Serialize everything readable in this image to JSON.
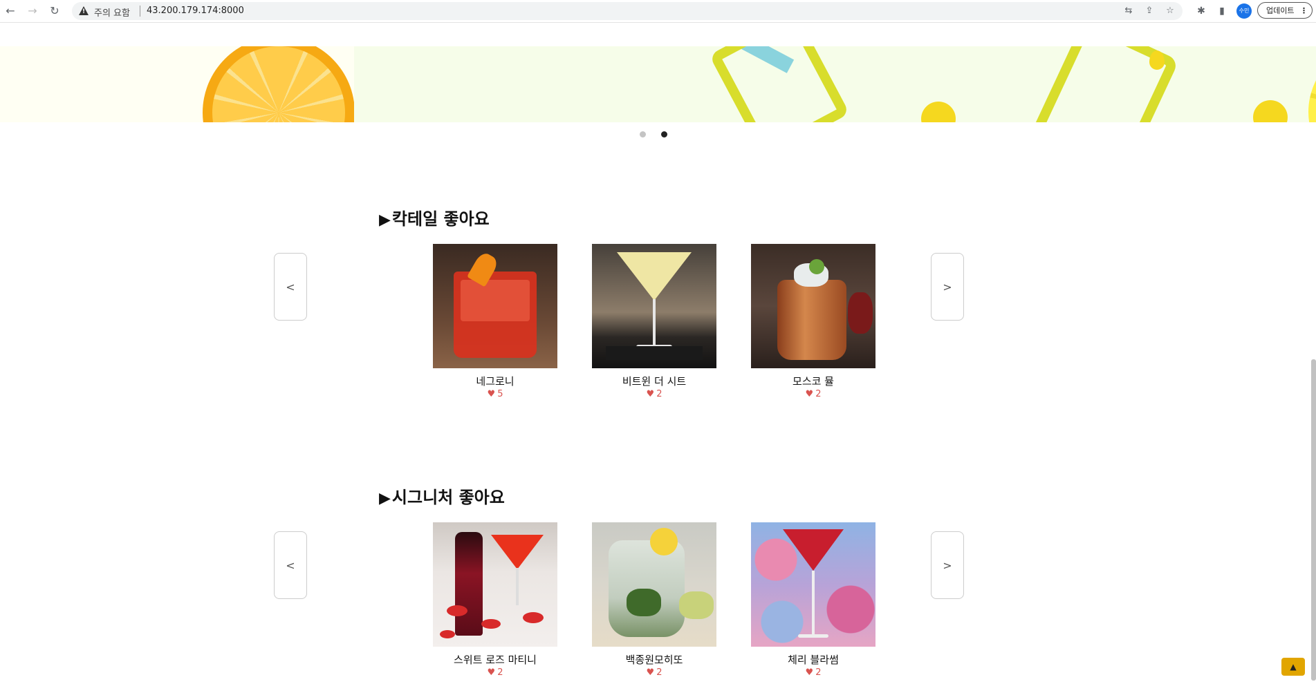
{
  "browser": {
    "security_warning": "주의 요함",
    "url": "43.200.179.174:8000",
    "profile_label": "수민",
    "update_label": "업데이트"
  },
  "carousel": {
    "slide_count": 2,
    "active_index": 1
  },
  "sections": [
    {
      "title": "칵테일 좋아요",
      "prev_label": "<",
      "next_label": ">",
      "items": [
        {
          "name": "네그로니",
          "likes": "5"
        },
        {
          "name": "비트윈 더 시트",
          "likes": "2"
        },
        {
          "name": "모스코 뮬",
          "likes": "2"
        }
      ]
    },
    {
      "title": "시그니처 좋아요",
      "prev_label": "<",
      "next_label": ">",
      "items": [
        {
          "name": "스위트 로즈 마티니",
          "likes": "2"
        },
        {
          "name": "백종원모히또",
          "likes": "2"
        },
        {
          "name": "체리 블라썸",
          "likes": "2"
        }
      ]
    }
  ],
  "scroll_top_label": "▲",
  "colors": {
    "heart": "#d9534f",
    "scroll_top_bg": "#e1a500"
  }
}
